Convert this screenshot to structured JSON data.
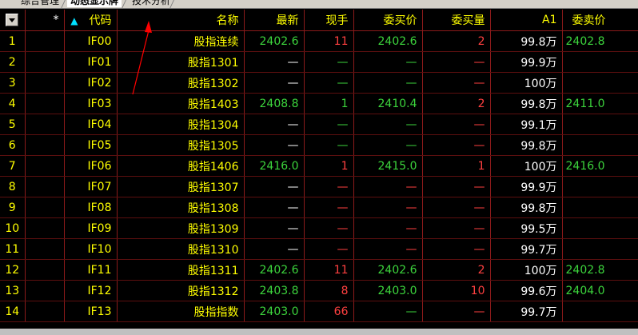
{
  "tabs": [
    {
      "label": "综合管理",
      "active": false
    },
    {
      "label": "动态显示牌",
      "active": true
    },
    {
      "label": "技术分析",
      "active": false
    }
  ],
  "columns": {
    "star": "*",
    "code": "代码",
    "name": "名称",
    "latest": "最新",
    "volume": "现手",
    "bid": "委买价",
    "bid_qty": "委买量",
    "a1": "A1",
    "ask": "委卖价"
  },
  "rows": [
    {
      "num": "1",
      "code": "IF00",
      "name": "股指连续",
      "latest": "2402.6",
      "latest_c": "green",
      "volume": "11",
      "volume_c": "red",
      "bid": "2402.6",
      "bid_c": "green",
      "bid_qty": "2",
      "qty_c": "red",
      "a1": "99.8万",
      "ask": "2402.8",
      "ask_c": "green"
    },
    {
      "num": "2",
      "code": "IF01",
      "name": "股指1301",
      "latest": "—",
      "latest_c": "white",
      "volume": "—",
      "volume_c": "green",
      "bid": "—",
      "bid_c": "green",
      "bid_qty": "—",
      "qty_c": "red",
      "a1": "99.9万",
      "ask": "",
      "ask_c": "green"
    },
    {
      "num": "3",
      "code": "IF02",
      "name": "股指1302",
      "latest": "—",
      "latest_c": "white",
      "volume": "—",
      "volume_c": "green",
      "bid": "—",
      "bid_c": "green",
      "bid_qty": "—",
      "qty_c": "red",
      "a1": "100万",
      "ask": "",
      "ask_c": "green"
    },
    {
      "num": "4",
      "code": "IF03",
      "name": "股指1403",
      "latest": "2408.8",
      "latest_c": "green",
      "volume": "1",
      "volume_c": "green",
      "bid": "2410.4",
      "bid_c": "green",
      "bid_qty": "2",
      "qty_c": "red",
      "a1": "99.8万",
      "ask": "2411.0",
      "ask_c": "green"
    },
    {
      "num": "5",
      "code": "IF04",
      "name": "股指1304",
      "latest": "—",
      "latest_c": "white",
      "volume": "—",
      "volume_c": "green",
      "bid": "—",
      "bid_c": "green",
      "bid_qty": "—",
      "qty_c": "red",
      "a1": "99.1万",
      "ask": "",
      "ask_c": "green"
    },
    {
      "num": "6",
      "code": "IF05",
      "name": "股指1305",
      "latest": "—",
      "latest_c": "white",
      "volume": "—",
      "volume_c": "green",
      "bid": "—",
      "bid_c": "green",
      "bid_qty": "—",
      "qty_c": "red",
      "a1": "99.8万",
      "ask": "",
      "ask_c": "green"
    },
    {
      "num": "7",
      "code": "IF06",
      "name": "股指1406",
      "latest": "2416.0",
      "latest_c": "green",
      "volume": "1",
      "volume_c": "red",
      "bid": "2415.0",
      "bid_c": "green",
      "bid_qty": "1",
      "qty_c": "red",
      "a1": "100万",
      "ask": "2416.0",
      "ask_c": "green"
    },
    {
      "num": "8",
      "code": "IF07",
      "name": "股指1307",
      "latest": "—",
      "latest_c": "white",
      "volume": "—",
      "volume_c": "red",
      "bid": "—",
      "bid_c": "red",
      "bid_qty": "—",
      "qty_c": "red",
      "a1": "99.9万",
      "ask": "",
      "ask_c": "green"
    },
    {
      "num": "9",
      "code": "IF08",
      "name": "股指1308",
      "latest": "—",
      "latest_c": "white",
      "volume": "—",
      "volume_c": "red",
      "bid": "—",
      "bid_c": "red",
      "bid_qty": "—",
      "qty_c": "red",
      "a1": "99.8万",
      "ask": "",
      "ask_c": "green"
    },
    {
      "num": "10",
      "code": "IF09",
      "name": "股指1309",
      "latest": "—",
      "latest_c": "white",
      "volume": "—",
      "volume_c": "red",
      "bid": "—",
      "bid_c": "red",
      "bid_qty": "—",
      "qty_c": "red",
      "a1": "99.5万",
      "ask": "",
      "ask_c": "green"
    },
    {
      "num": "11",
      "code": "IF10",
      "name": "股指1310",
      "latest": "—",
      "latest_c": "white",
      "volume": "—",
      "volume_c": "red",
      "bid": "—",
      "bid_c": "red",
      "bid_qty": "—",
      "qty_c": "red",
      "a1": "99.7万",
      "ask": "",
      "ask_c": "green"
    },
    {
      "num": "12",
      "code": "IF11",
      "name": "股指1311",
      "latest": "2402.6",
      "latest_c": "green",
      "volume": "11",
      "volume_c": "red",
      "bid": "2402.6",
      "bid_c": "green",
      "bid_qty": "2",
      "qty_c": "red",
      "a1": "100万",
      "ask": "2402.8",
      "ask_c": "green"
    },
    {
      "num": "13",
      "code": "IF12",
      "name": "股指1312",
      "latest": "2403.8",
      "latest_c": "green",
      "volume": "8",
      "volume_c": "red",
      "bid": "2403.0",
      "bid_c": "green",
      "bid_qty": "10",
      "qty_c": "red",
      "a1": "99.6万",
      "ask": "2404.0",
      "ask_c": "green"
    },
    {
      "num": "14",
      "code": "IF13",
      "name": "股指指数",
      "latest": "2403.0",
      "latest_c": "green",
      "volume": "66",
      "volume_c": "red",
      "bid": "—",
      "bid_c": "green",
      "bid_qty": "—",
      "qty_c": "red",
      "a1": "99.7万",
      "ask": "",
      "ask_c": "green"
    }
  ],
  "colors": {
    "green": "#3cd43c",
    "red": "#ff4040",
    "white": "#ffffff",
    "yellow": "#ffff00",
    "grid": "#8b1a1a"
  },
  "icons": {
    "menu": "dropdown-menu-icon",
    "sort": "sort-ascending-icon",
    "annotation": "red-arrow-annotation"
  }
}
